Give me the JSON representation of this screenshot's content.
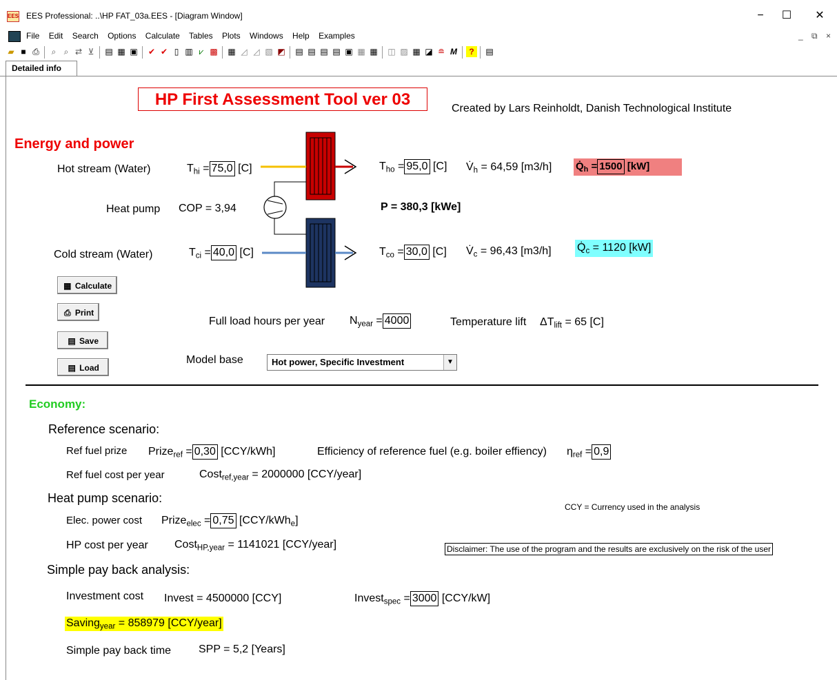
{
  "window": {
    "title": "EES Professional:  ..\\HP FAT_03a.EES - [Diagram Window]",
    "app_icon": "EES",
    "controls": {
      "minimize": "−",
      "maximize": "☐",
      "close": "✕"
    }
  },
  "menu": {
    "items": [
      "File",
      "Edit",
      "Search",
      "Options",
      "Calculate",
      "Tables",
      "Plots",
      "Windows",
      "Help",
      "Examples"
    ],
    "mdi_controls": [
      "_",
      "⧉",
      "×"
    ]
  },
  "tab": {
    "label": "Detailed info"
  },
  "header": {
    "title": "HP First Assessment Tool ver 03",
    "credit": "Created by Lars Reinholdt, Danish Technological Institute"
  },
  "energy": {
    "heading": "Energy and power",
    "hot_stream_label": "Hot stream (Water)",
    "heat_pump_label": "Heat pump",
    "cold_stream_label": "Cold stream (Water)",
    "T_hi": {
      "symbol": "T",
      "sub": "hi",
      "value": "75,0",
      "unit": "[C]"
    },
    "T_ho": {
      "symbol": "T",
      "sub": "ho",
      "value": "95,0",
      "unit": "[C]"
    },
    "V_h": {
      "symbol": "V̇",
      "sub": "h",
      "text": " = 64,59 [m3/h]"
    },
    "Q_h": {
      "symbol": "Q̇",
      "sub": "h",
      "value": "1500",
      "unit": "[kW]"
    },
    "COP": "COP = 3,94",
    "P": "P = 380,3 [kWe]",
    "T_ci": {
      "symbol": "T",
      "sub": "ci",
      "value": "40,0",
      "unit": "[C]"
    },
    "T_co": {
      "symbol": "T",
      "sub": "co",
      "value": "30,0",
      "unit": "[C]"
    },
    "V_c": {
      "symbol": "V̇",
      "sub": "c",
      "text": " = 96,43 [m3/h]"
    },
    "Q_c": {
      "symbol": "Q̇",
      "sub": "c",
      "text": " = 1120 [kW]"
    },
    "full_load_label": "Full load hours per year",
    "N_year": {
      "symbol": "N",
      "sub": "year",
      "value": "4000"
    },
    "temp_lift_label": "Temperature lift",
    "T_lift": {
      "symbol": "ΔT",
      "sub": "lift",
      "text": " = 65 [C]"
    },
    "model_base_label": "Model base",
    "model_base_value": "Hot power, Specific Investment"
  },
  "buttons": {
    "calculate": "Calculate",
    "print": "Print",
    "save": "Save",
    "load": "Load"
  },
  "economy": {
    "heading": "Economy:",
    "reference_heading": "Reference scenario:",
    "ref_fuel_prize_label": "Ref fuel prize",
    "prize_ref": {
      "symbol": "Prize",
      "sub": "ref",
      "value": "0,30",
      "unit": "[CCY/kWh]"
    },
    "efficiency_label": "Efficiency of reference fuel (e.g. boiler effiency)",
    "eta_ref": {
      "symbol": "η",
      "sub": "ref",
      "value": "0,9"
    },
    "ref_cost_label": "Ref fuel cost per year",
    "cost_ref_year": {
      "symbol": "Cost",
      "sub": "ref,year",
      "text": " = 2000000 [CCY/year]"
    },
    "hp_heading": "Heat pump scenario:",
    "elec_cost_label": "Elec. power cost",
    "prize_elec": {
      "symbol": "Prize",
      "sub": "elec",
      "value": "0,75",
      "unit": "[CCY/kWh",
      "unit_sub": "e",
      "unit_end": "]"
    },
    "ccy_note": "CCY = Currency used in the analysis",
    "hp_cost_label": "HP cost per year",
    "cost_hp_year": {
      "symbol": "Cost",
      "sub": "HP,year",
      "text": " = 1141021 [CCY/year]"
    },
    "disclaimer": "Disclaimer: The use of the program and the results are exclusively on the risk of the user",
    "payback_heading": "Simple pay back analysis:",
    "investment_label": "Investment cost",
    "invest": "Invest = 4500000 [CCY]",
    "invest_spec": {
      "symbol": "Invest",
      "sub": "spec",
      "value": "3000",
      "unit": "[CCY/kW]"
    },
    "saving_year": {
      "symbol": "Saving",
      "sub": "year",
      "text": " = 858979 [CCY/year]"
    },
    "spp_label": "Simple pay back time",
    "spp": "SPP = 5,2 [Years]"
  },
  "colors": {
    "hot": "#c80000",
    "cold": "#1d3461",
    "hot_line": "#f5c000",
    "cold_line": "#5b8ac6",
    "qh_bg": "#f08080",
    "qc_bg": "#7fffff",
    "saving_bg": "#ffff00",
    "accent_red": "#e00000",
    "accent_green": "#22cc22"
  }
}
